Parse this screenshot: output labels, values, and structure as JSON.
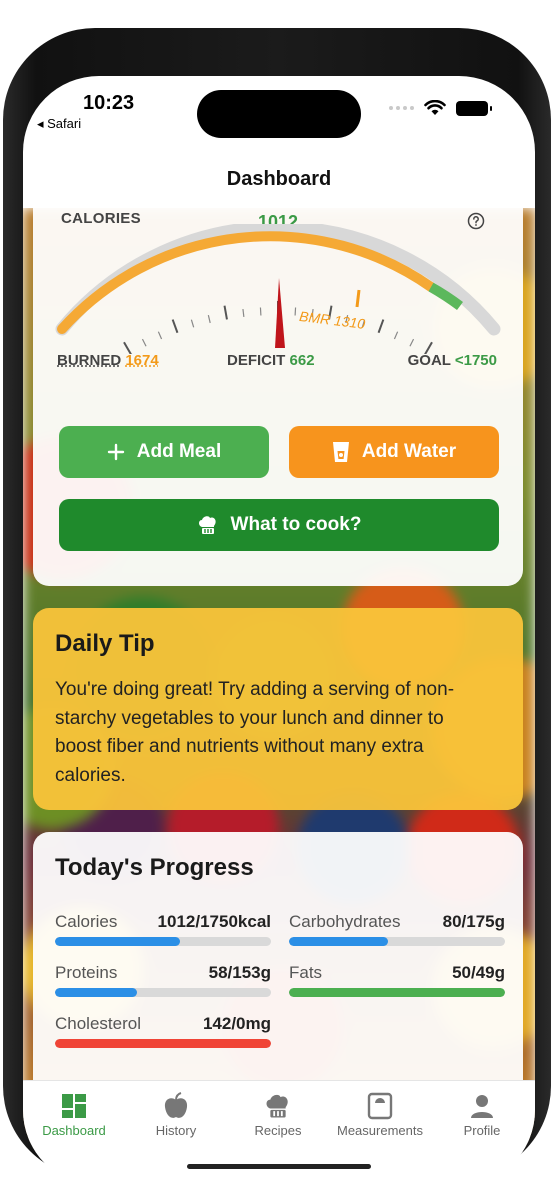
{
  "status": {
    "time": "10:23",
    "back_app": "◂ Safari"
  },
  "navbar": {
    "title": "Dashboard"
  },
  "calories": {
    "label": "CALORIES",
    "consumed": "1012",
    "bmr_label": "BMR 1310",
    "burned_label": "BURNED",
    "burned_value": "1674",
    "deficit_label": "DEFICIT",
    "deficit_value": "662",
    "goal_label": "GOAL",
    "goal_value": "<1750"
  },
  "buttons": {
    "add_meal": "Add Meal",
    "add_water": "Add Water",
    "what_to_cook": "What to cook?"
  },
  "tip": {
    "title": "Daily Tip",
    "text": "You're doing great! Try adding a serving of non-starchy vegetables to your lunch and dinner to boost fiber and nutrients without many extra calories."
  },
  "progress": {
    "title": "Today's Progress",
    "items": [
      {
        "label": "Calories",
        "value": "1012/1750kcal",
        "fraction": 0.58,
        "color": "#2b8fe6"
      },
      {
        "label": "Carbohydrates",
        "value": "80/175g",
        "fraction": 0.46,
        "color": "#2b8fe6"
      },
      {
        "label": "Proteins",
        "value": "58/153g",
        "fraction": 0.38,
        "color": "#2b8fe6"
      },
      {
        "label": "Fats",
        "value": "50/49g",
        "fraction": 1.0,
        "color": "#4caf50"
      },
      {
        "label": "Cholesterol",
        "value": "142/0mg",
        "fraction": 1.0,
        "color": "#f04436"
      }
    ]
  },
  "tabs": [
    {
      "label": "Dashboard",
      "icon": "dashboard-icon",
      "active": true
    },
    {
      "label": "History",
      "icon": "apple-icon",
      "active": false
    },
    {
      "label": "Recipes",
      "icon": "chef-hat-icon",
      "active": false
    },
    {
      "label": "Measurements",
      "icon": "scale-icon",
      "active": false
    },
    {
      "label": "Profile",
      "icon": "person-icon",
      "active": false
    }
  ],
  "colors": {
    "green": "#4caf50",
    "dark_green": "#1f8a2c",
    "orange": "#f7941d",
    "tip_yellow": "#fac43a",
    "blue": "#2b8fe6",
    "red": "#f04436"
  }
}
